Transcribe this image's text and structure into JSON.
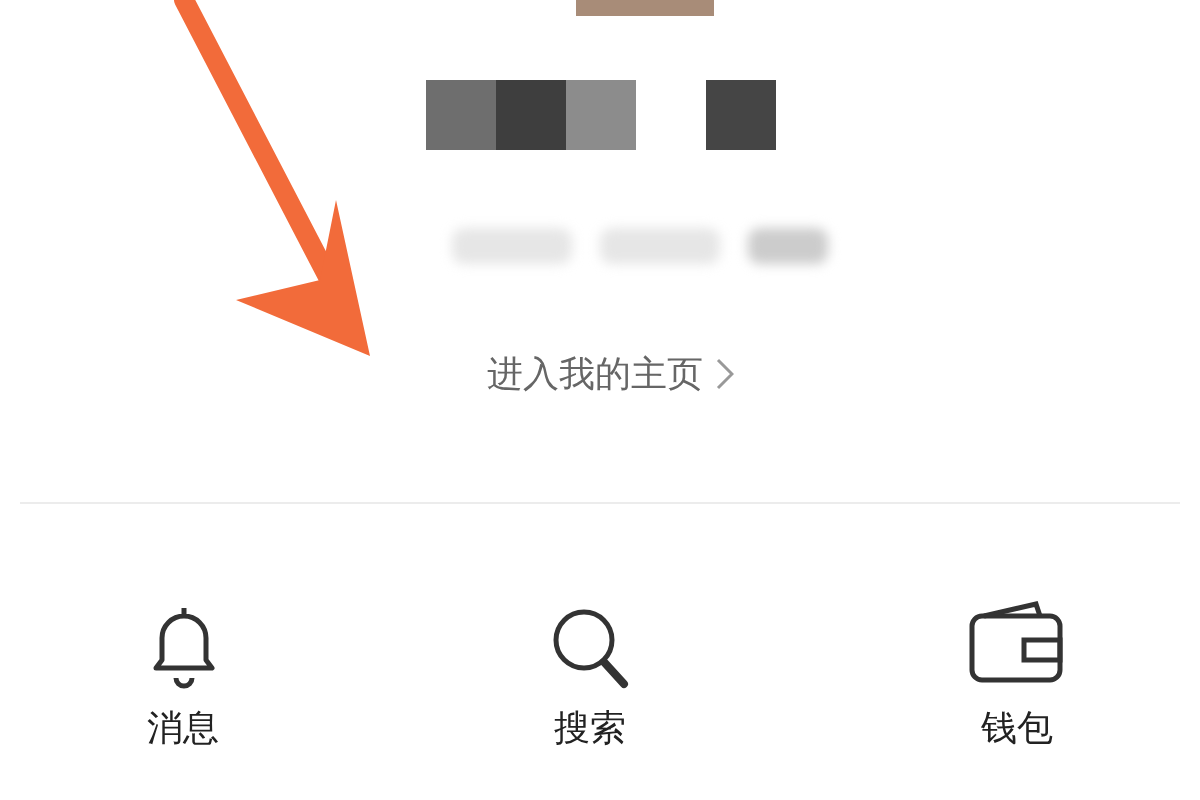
{
  "profile_link": {
    "label": "进入我的主页"
  },
  "shortcuts": [
    {
      "label": "消息",
      "kind": "bell"
    },
    {
      "label": "搜索",
      "kind": "search"
    },
    {
      "label": "钱包",
      "kind": "wallet"
    }
  ]
}
